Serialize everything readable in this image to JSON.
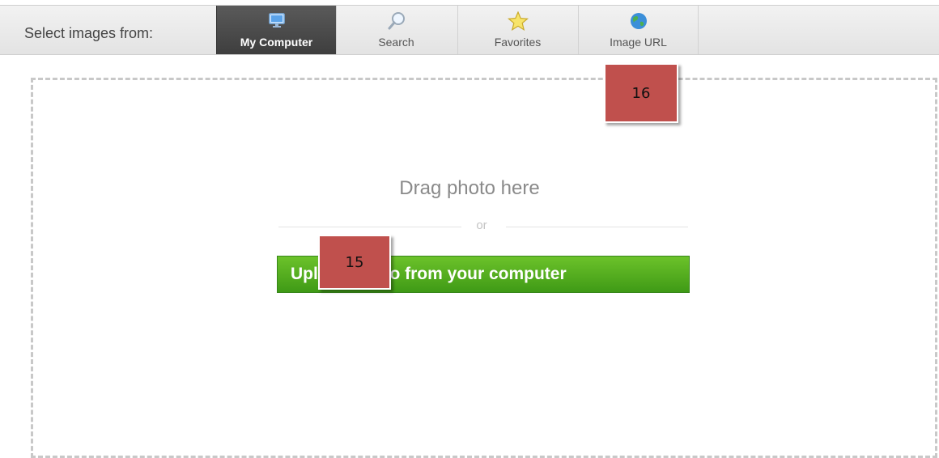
{
  "toolbar": {
    "select_label": "Select images from:",
    "tabs": [
      {
        "label": "My Computer",
        "icon": "monitor-icon",
        "active": true
      },
      {
        "label": "Search",
        "icon": "magnifier-icon",
        "active": false
      },
      {
        "label": "Favorites",
        "icon": "star-icon",
        "active": false
      },
      {
        "label": "Image URL",
        "icon": "globe-icon",
        "active": false
      }
    ]
  },
  "dropzone": {
    "drag_text": "Drag photo here",
    "or_text": "or",
    "upload_button": "Upload photo from your computer"
  },
  "annotations": {
    "badge_15": "15",
    "badge_16": "16"
  },
  "colors": {
    "active_tab": "#444444",
    "upload_green": "#4fae1e",
    "badge_red": "#c0504d"
  }
}
